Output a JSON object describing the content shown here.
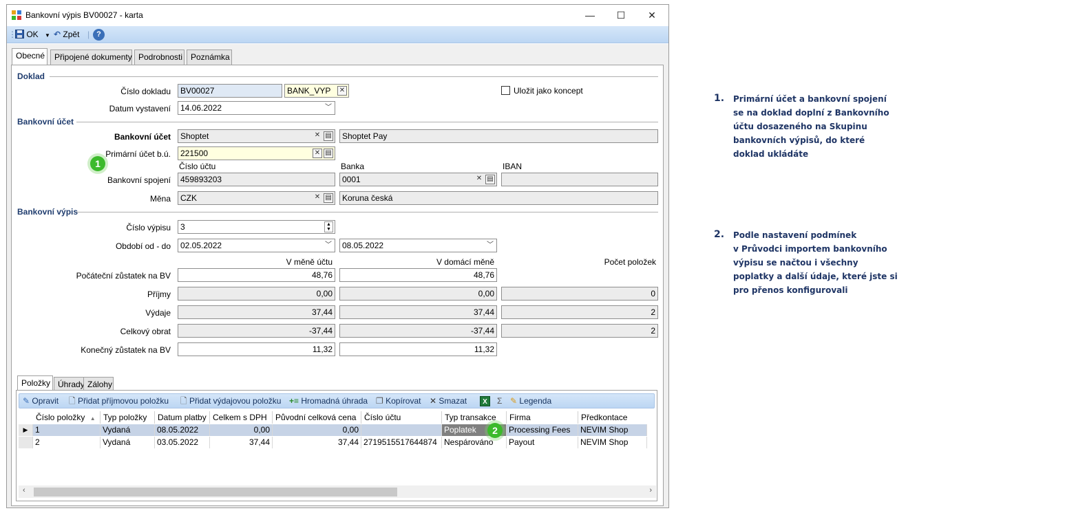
{
  "window": {
    "title": "Bankovní výpis BV00027 - karta",
    "controls": {
      "minimize": "—",
      "maximize": "☐",
      "close": "✕"
    }
  },
  "toolbar": {
    "ok_label": "OK",
    "back_label": "Zpět",
    "help_label": "?"
  },
  "tabs": [
    {
      "label": "Obecné",
      "active": true
    },
    {
      "label": "Připojené dokumenty"
    },
    {
      "label": "Podrobnosti"
    },
    {
      "label": "Poznámka"
    }
  ],
  "doklad": {
    "section": "Doklad",
    "number_label": "Číslo dokladu",
    "number_value": "BV00027",
    "series_value": "BANK_VYP",
    "draft_label": "Uložit jako koncept",
    "date_label": "Datum vystavení",
    "date_value": "14.06.2022"
  },
  "bank_account": {
    "section": "Bankovní účet",
    "account_label": "Bankovní účet",
    "account_code": "Shoptet",
    "account_name": "Shoptet Pay",
    "primary_label": "Primární účet b.ú.",
    "primary_value": "221500",
    "col_account": "Číslo účtu",
    "col_bank": "Banka",
    "col_iban": "IBAN",
    "connection_label": "Bankovní spojení",
    "account_number": "459893203",
    "bank_code": "0001",
    "iban": "",
    "currency_label": "Měna",
    "currency_code": "CZK",
    "currency_name": "Koruna česká"
  },
  "statement": {
    "section": "Bankovní výpis",
    "number_label": "Číslo výpisu",
    "number_value": "3",
    "period_label": "Období od - do",
    "period_from": "02.05.2022",
    "period_to": "08.05.2022",
    "col_account_currency": "V měně účtu",
    "col_home_currency": "V domácí měně",
    "col_count": "Počet položek",
    "rows": [
      {
        "label": "Počáteční zůstatek na BV",
        "acc": "48,76",
        "home": "48,76",
        "count": null
      },
      {
        "label": "Příjmy",
        "acc": "0,00",
        "home": "0,00",
        "count": "0"
      },
      {
        "label": "Výdaje",
        "acc": "37,44",
        "home": "37,44",
        "count": "2"
      },
      {
        "label": "Celkový obrat",
        "acc": "-37,44",
        "home": "-37,44",
        "count": "2"
      },
      {
        "label": "Konečný zůstatek na BV",
        "acc": "11,32",
        "home": "11,32",
        "count": null
      }
    ]
  },
  "bottom_tabs": [
    {
      "label": "Položky",
      "active": true
    },
    {
      "label": "Úhrady"
    },
    {
      "label": "Zálohy"
    }
  ],
  "grid_toolbar": {
    "edit": "Opravit",
    "add_income": "Přidat příjmovou položku",
    "add_expense": "Přidat výdajovou položku",
    "bulk_payment": "Hromadná úhrada",
    "copy": "Kopírovat",
    "delete": "Smazat",
    "sigma": "Σ",
    "legend": "Legenda"
  },
  "grid": {
    "columns": [
      "Číslo položky",
      "Typ položky",
      "Datum platby",
      "Celkem s DPH",
      "Původní celková cena",
      "Číslo účtu",
      "Typ transakce",
      "Firma",
      "Předkontace"
    ],
    "rows": [
      [
        "1",
        "Vydaná",
        "08.05.2022",
        "0,00",
        "0,00",
        "",
        "Poplatek",
        "Processing Fees",
        "NEVIM Shop"
      ],
      [
        "2",
        "Vydaná",
        "03.05.2022",
        "37,44",
        "37,44",
        "2719515517644874",
        "Nespárováno",
        "Payout",
        "NEVIM Shop"
      ]
    ]
  },
  "badges": {
    "one": "1",
    "two": "2"
  },
  "notes": [
    {
      "num": "1.",
      "text": "Primární účet a bankovní spojení\nse na doklad doplní z Bankovního\núčtu dosazeného na Skupinu\nbankovních výpisů, do které\ndoklad ukládáte"
    },
    {
      "num": "2.",
      "text": "Podle nastavení podmínek\nv Průvodci importem bankovního\nvýpisu se načtou i všechny\npoplatky a další údaje, které jste si\npro přenos konfigurovali"
    }
  ]
}
